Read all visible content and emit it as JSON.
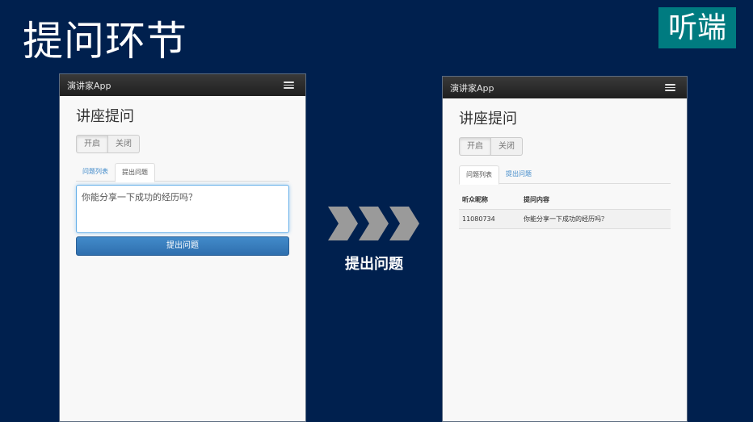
{
  "slide": {
    "title": "提问环节",
    "badge": "听端",
    "arrow_caption": "提出问题"
  },
  "left_phone": {
    "app_name": "演讲家App",
    "page_title": "讲座提问",
    "toggle": {
      "on": "开启",
      "off": "关闭"
    },
    "tabs": [
      "问题列表",
      "提出问题"
    ],
    "active_tab": "提出问题",
    "question_value": "你能分享一下成功的经历吗？",
    "submit_label": "提出问题"
  },
  "right_phone": {
    "app_name": "演讲家App",
    "page_title": "讲座提问",
    "toggle": {
      "on": "开启",
      "off": "关闭"
    },
    "tabs": [
      "问题列表",
      "提出问题"
    ],
    "active_tab": "问题列表",
    "table": {
      "headers": [
        "听众昵称",
        "提问内容"
      ],
      "rows": [
        [
          "11080734",
          "你能分享一下成功的经历吗？"
        ]
      ]
    }
  },
  "colors": {
    "background": "#00204e",
    "badge": "#007b80",
    "primary_button": "#428bca",
    "arrows": "#9a9a9a"
  }
}
